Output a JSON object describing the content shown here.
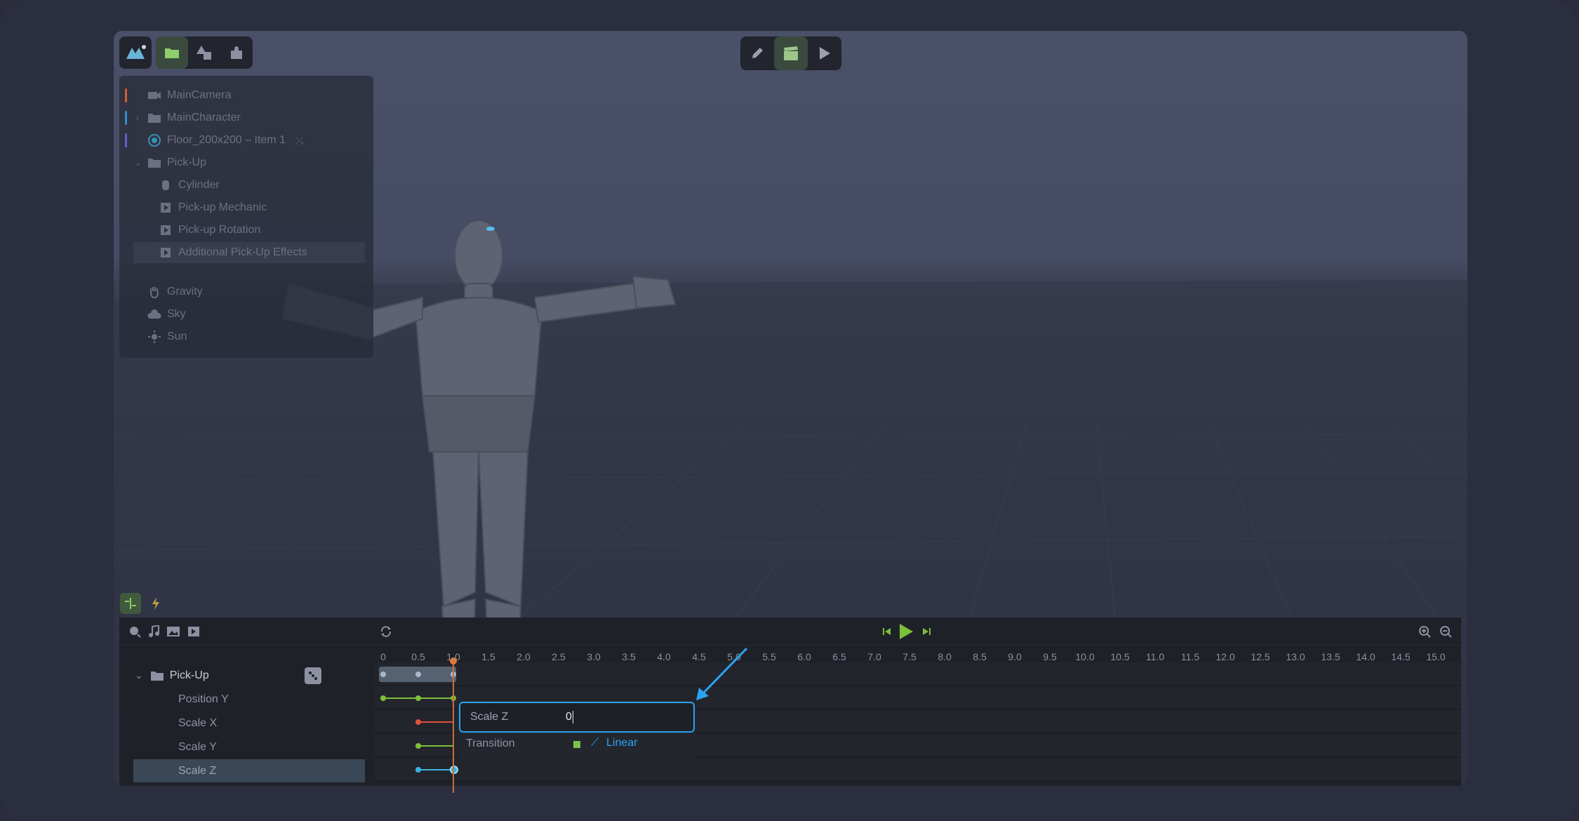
{
  "scene": {
    "items": [
      {
        "label": "MainCamera",
        "icon": "camera-icon",
        "bar": "#d0612d"
      },
      {
        "label": "MainCharacter",
        "icon": "folder-icon",
        "bar": "#2d8fd0"
      },
      {
        "label": "Floor_200x200 – Item 1",
        "icon": "globe-icon",
        "bar": "#6a5bd0"
      },
      {
        "label": "Pick-Up",
        "icon": "folder-icon"
      },
      {
        "label": "Cylinder",
        "icon": "cylinder-icon"
      },
      {
        "label": "Pick-up Mechanic",
        "icon": "script-icon"
      },
      {
        "label": "Pick-up Rotation",
        "icon": "script-icon"
      },
      {
        "label": "Additional Pick-Up Effects",
        "icon": "script-icon"
      },
      {
        "label": "Gravity",
        "icon": "hand-icon"
      },
      {
        "label": "Sky",
        "icon": "cloud-icon"
      },
      {
        "label": "Sun",
        "icon": "sun-icon"
      }
    ]
  },
  "timeline": {
    "ticks": [
      "0",
      "0.5",
      "1.0",
      "1.5",
      "2.0",
      "2.5",
      "3.0",
      "3.5",
      "4.0",
      "4.5",
      "5.0",
      "5.5",
      "6.0",
      "6.5",
      "7.0",
      "7.5",
      "8.0",
      "8.5",
      "9.0",
      "9.5",
      "10.0",
      "10.5",
      "11.0",
      "11.5",
      "12.0",
      "12.5",
      "13.0",
      "13.5",
      "14.0",
      "14.5",
      "15.0"
    ],
    "playhead_time": 1.0,
    "layers": [
      {
        "label": "Pick-Up",
        "type": "group"
      },
      {
        "label": "Position Y",
        "color": "#7ebf3a"
      },
      {
        "label": "Scale X",
        "color": "#e0523a"
      },
      {
        "label": "Scale Y",
        "color": "#7ebf3a"
      },
      {
        "label": "Scale Z",
        "color": "#3ab4e0"
      }
    ]
  },
  "popover": {
    "field_label": "Scale Z",
    "field_value": "0",
    "transition_label": "Transition",
    "transition_value": "Linear"
  },
  "colors": {
    "accent_blue": "#2aa3f2",
    "playhead": "#e07a38",
    "green": "#7ebf3a"
  }
}
